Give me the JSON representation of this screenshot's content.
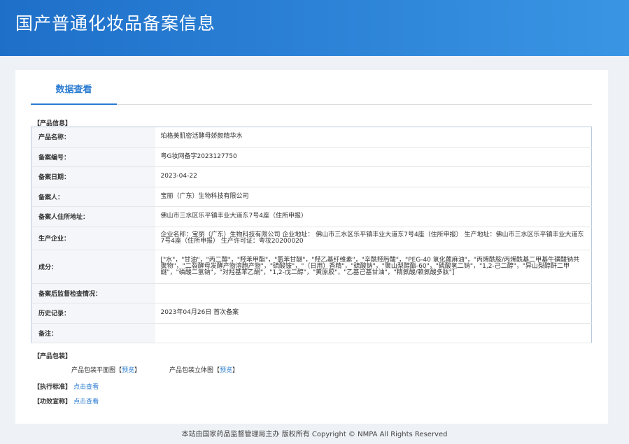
{
  "header": {
    "title": "国产普通化妆品备案信息"
  },
  "tab": "数据查看",
  "sections": {
    "product_info": "【产品信息】",
    "packaging": "【产品包装】",
    "standard": "【执行标准】",
    "efficacy": "【功效宣称】"
  },
  "rows": [
    {
      "label": "产品名称：",
      "value": "珀格美肌密活酵母娇颜精华水"
    },
    {
      "label": "备案编号：",
      "value": "粤G妆网备字2023127750"
    },
    {
      "label": "备案日期：",
      "value": "2023-04-22"
    },
    {
      "label": "备案人：",
      "value": "宝丽（广东）生物科技有限公司"
    },
    {
      "label": "备案人住所地址：",
      "value": "佛山市三水区乐平镇丰业大道东7号4座（住所申报）"
    },
    {
      "label": "生产企业：",
      "value": "企业名称：宝丽（广东）生物科技有限公司 企业地址： 佛山市三水区乐平镇丰业大道东7号4座（住所申报） 生产地址：佛山市三水区乐平镇丰业大道东7号4座（住所申报） 生产许可证：粤妆20200020"
    },
    {
      "label": "成分：",
      "value": "[\"水\"，\"甘油\"，\"丙二醇\"，\"羟苯甲酯\"，\"氯苯甘醚\"，\"羟乙基纤维素\"，\"辛酰羟肟酸\"，\"PEG-40 氢化蓖麻油\"，\"丙烯酰胺/丙烯酰基二甲基牛磺酸钠共聚物\"，\"二裂酵母发酵产物溶胞产物\"，\"硫酸铵\"，\"（日用）香精\"，\"硫酸钠\"，\"聚山梨醇酯-60\"，\"磷酸氢二钠\"，\"1,2-己二醇\"，\"异山梨醇酐二甲醚\"，\"磷酸二氢钠\"，\"对羟基苯乙酮\"，\"1,2-戊二醇\"，\"黄原胶\"，\"乙基己基甘油\"，\"精氨酸/赖氨酸多肽\"]"
    },
    {
      "label": "备案后监督检查情况：",
      "value": ""
    },
    {
      "label": "历史记录：",
      "value": "2023年04月26日 首次备案"
    },
    {
      "label": "备注：",
      "value": ""
    }
  ],
  "packaging": {
    "flat": "产品包装平面图",
    "solid": "产品包装立体图",
    "preview_open": "【",
    "preview": "预览",
    "preview_close": "】"
  },
  "links": {
    "view": "点击查看"
  },
  "footer": "本站由国家药品监督管理局主办 版权所有 Copyright © NMPA All Rights Reserved"
}
